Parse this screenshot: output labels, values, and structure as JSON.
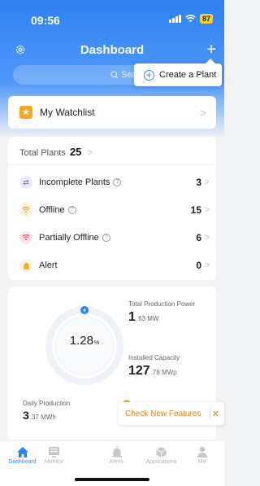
{
  "status_bar": {
    "time": "09:56",
    "battery": "87"
  },
  "header": {
    "title": "Dashboard",
    "add_label": "+"
  },
  "search": {
    "placeholder": "Search"
  },
  "popup": {
    "create_plant": "Create a Plant"
  },
  "watchlist": {
    "label": "My Watchlist"
  },
  "plants": {
    "total_label": "Total Plants",
    "total_value": "25",
    "rows": [
      {
        "label": "Incomplete Plants",
        "value": "3",
        "icon": "sync-icon",
        "color": "#7b6ee6"
      },
      {
        "label": "Offline",
        "value": "15",
        "icon": "wifi-icon",
        "color": "#f5a623"
      },
      {
        "label": "Partially Offline",
        "value": "6",
        "icon": "wifi-warning-icon",
        "color": "#ef5350"
      },
      {
        "label": "Alert",
        "value": "0",
        "icon": "alert-icon",
        "color": "#f5a623"
      }
    ]
  },
  "production": {
    "ring_value": "1.28",
    "ring_unit": "%",
    "ring_fraction": 0.0128,
    "total_power_label": "Total Production Power",
    "total_power_int": "1",
    "total_power_rest": ".63 MW",
    "capacity_label": "Installed Capacity",
    "capacity_int": "127",
    "capacity_rest": ".78 MWp",
    "daily_label": "Daily Production",
    "daily_int": "3",
    "daily_rest": ".37 MWh"
  },
  "banner": {
    "text": "Check New Features",
    "close": "✕"
  },
  "tabs": [
    {
      "label": "Dashboard",
      "icon": "home-icon",
      "active": true
    },
    {
      "label": "Monitor",
      "icon": "monitor-icon",
      "active": false
    },
    {
      "label": "Alerts",
      "icon": "bell-icon",
      "active": false
    },
    {
      "label": "Applications",
      "icon": "cube-icon",
      "active": false
    },
    {
      "label": "Me",
      "icon": "person-icon",
      "active": false
    }
  ],
  "colors": {
    "primary": "#2f82f5",
    "accent": "#f07f14"
  }
}
